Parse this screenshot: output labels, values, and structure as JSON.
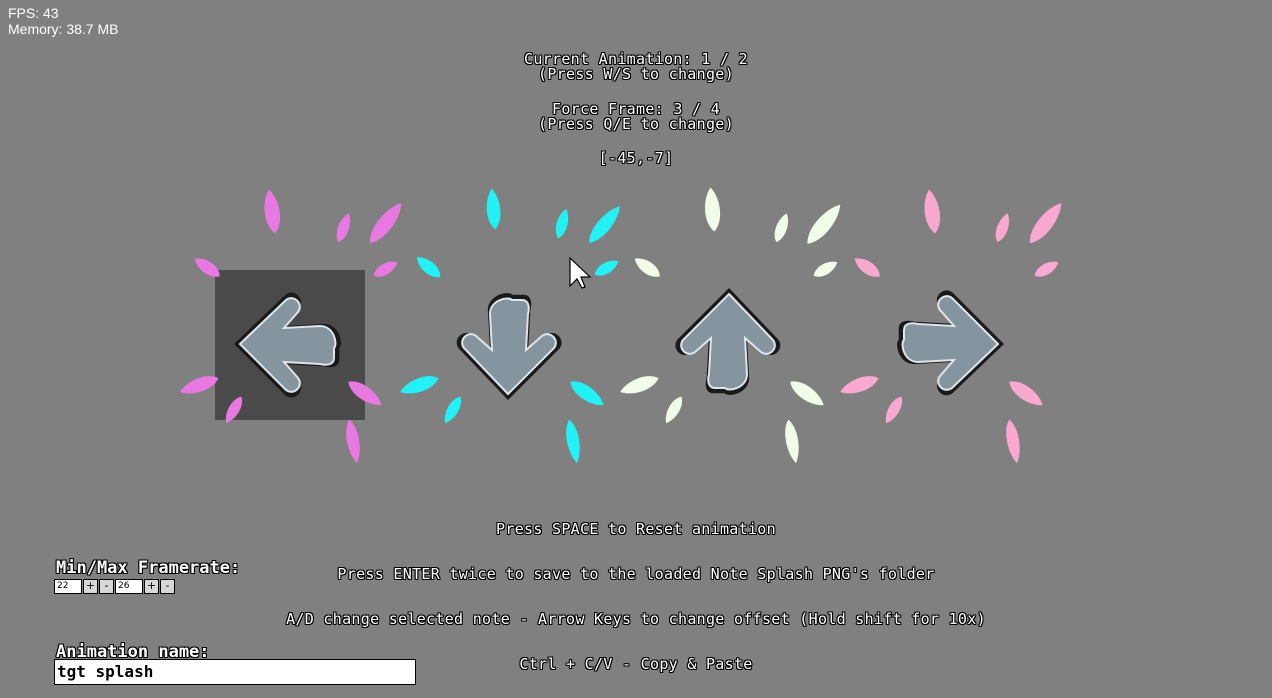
{
  "debug": {
    "fps": "FPS: 43",
    "memory": "Memory: 38.7 MB"
  },
  "header": {
    "current_animation": "Current Animation: 1 / 2",
    "press_ws": "(Press W/S to change)",
    "force_frame": "Force Frame: 3 / 4",
    "press_qe": "(Press Q/E to change)",
    "offset": "[-45,-7]"
  },
  "notes": [
    {
      "name": "left",
      "splash_color": "#e879e0",
      "selected": true
    },
    {
      "name": "down",
      "splash_color": "#22f2f5",
      "selected": false
    },
    {
      "name": "up",
      "splash_color": "#f0fbe8",
      "selected": false
    },
    {
      "name": "right",
      "splash_color": "#f9a8d0",
      "selected": false
    }
  ],
  "colors": {
    "background": "#808080",
    "selection_box": "#4a4a4a",
    "arrow_fill": "#8495a0",
    "arrow_outline": "#1a1a1a"
  },
  "instructions": {
    "space": "Press SPACE to Reset animation",
    "enter": "Press ENTER twice to save to the loaded Note Splash PNG's folder",
    "ad": "A/D change selected note - Arrow Keys to change offset (Hold shift for 10x)",
    "copy": "Ctrl + C/V - Copy & Paste"
  },
  "framerate": {
    "label": "Min/Max Framerate:",
    "min": "22",
    "max": "26",
    "plus": "+",
    "minus": "-"
  },
  "animation_name": {
    "label": "Animation name:",
    "value": "tgt splash"
  }
}
